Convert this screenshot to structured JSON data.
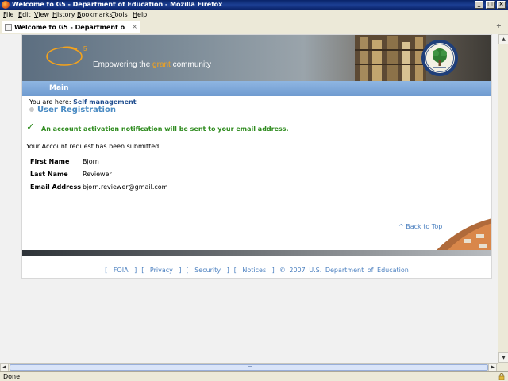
{
  "window": {
    "title": "Welcome to G5 - Department of Education - Mozilla Firefox",
    "controls": {
      "minimize": "_",
      "maximize": "□",
      "close": "×"
    }
  },
  "menu": [
    "File",
    "Edit",
    "View",
    "History",
    "Bookmarks",
    "Tools",
    "Help"
  ],
  "tab": {
    "label": "Welcome to G5 - Department of Edu...",
    "close": "×",
    "scroll": "÷"
  },
  "banner": {
    "logo_text": "G5",
    "tagline_pre": "Empowering the ",
    "tagline_highlight": "grant",
    "tagline_post": " community",
    "accent_color": "#f5a31b"
  },
  "mainbar": {
    "label": "Main"
  },
  "breadcrumb": {
    "prefix": "You are here:",
    "link": "Self management"
  },
  "section_title": "User Registration",
  "notice": {
    "icon": "✓",
    "message": "An account activation notification will be sent to your email address."
  },
  "submitted_text": "Your Account request has been submitted.",
  "fields": [
    {
      "label": "First Name",
      "value": "Bjorn"
    },
    {
      "label": "Last Name",
      "value": "Reviewer"
    },
    {
      "label": "Email Address",
      "value": "bjorn.reviewer@gmail.com"
    }
  ],
  "back_to_top": "^ Back to Top",
  "footer": {
    "links": [
      "FOIA",
      "Privacy",
      "Security",
      "Notices"
    ],
    "copyright": "©  2007  U.S.  Department  of  Education"
  },
  "status": {
    "text": "Done"
  },
  "colors": {
    "success": "#2e8b1e",
    "link": "#4a7fbf",
    "mainbar": "#7ba6d8"
  }
}
